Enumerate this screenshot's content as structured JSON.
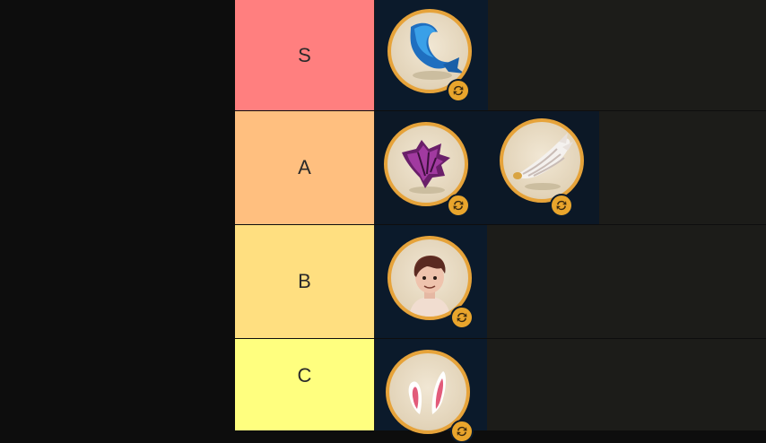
{
  "tiers": [
    {
      "label": "S",
      "color": "#ff7f7f",
      "items": [
        "dolphin-tail-icon"
      ]
    },
    {
      "label": "A",
      "color": "#ffbf7f",
      "items": [
        "demon-wing-icon",
        "angel-wing-icon"
      ]
    },
    {
      "label": "B",
      "color": "#ffdf80",
      "items": [
        "boy-face-icon"
      ]
    },
    {
      "label": "C",
      "color": "#ffff7f",
      "items": [
        "bunny-ears-icon"
      ]
    }
  ],
  "badge_icon": "refresh-icon",
  "colors": {
    "item_bg": "#0b1a2b",
    "lane_bg": "#1c1c19",
    "coin_ring": "#e6a33a"
  }
}
